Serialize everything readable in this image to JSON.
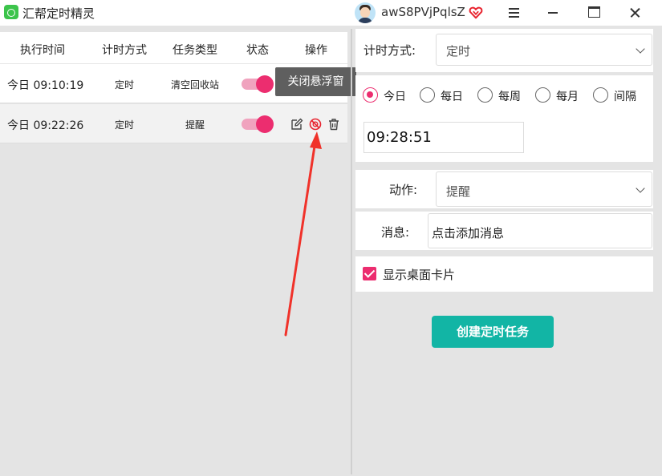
{
  "app": {
    "title": "汇帮定时精灵",
    "username": "awS8PVjPqlsZ",
    "accent_color": "#ec2d6f",
    "primary_button_color": "#12b5a5"
  },
  "table": {
    "columns": [
      "执行时间",
      "计时方式",
      "任务类型",
      "状态",
      "操作"
    ],
    "rows": [
      {
        "time": "今日 09:10:19",
        "mode": "定时",
        "type": "清空回收站",
        "enabled": true
      },
      {
        "time": "今日 09:22:26",
        "mode": "定时",
        "type": "提醒",
        "enabled": true
      }
    ],
    "tooltip": "关闭悬浮窗"
  },
  "settings": {
    "timing_label": "计时方式:",
    "timing_value": "定时",
    "frequency_options": [
      "今日",
      "每日",
      "每周",
      "每月",
      "间隔"
    ],
    "frequency_selected": "今日",
    "time_value": "09:28:51",
    "action_label": "动作:",
    "action_value": "提醒",
    "message_label": "消息:",
    "message_value": "点击添加消息",
    "desktop_card_label": "显示桌面卡片",
    "desktop_card_checked": true,
    "create_button": "创建定时任务"
  },
  "icons": {
    "title_bar": [
      "app-logo-icon",
      "user-avatar-icon",
      "vip-heart-icon",
      "menu-icon",
      "minimize-icon",
      "maximize-icon",
      "close-icon"
    ],
    "row_actions": [
      "edit-icon",
      "float-window-icon",
      "delete-icon"
    ]
  }
}
